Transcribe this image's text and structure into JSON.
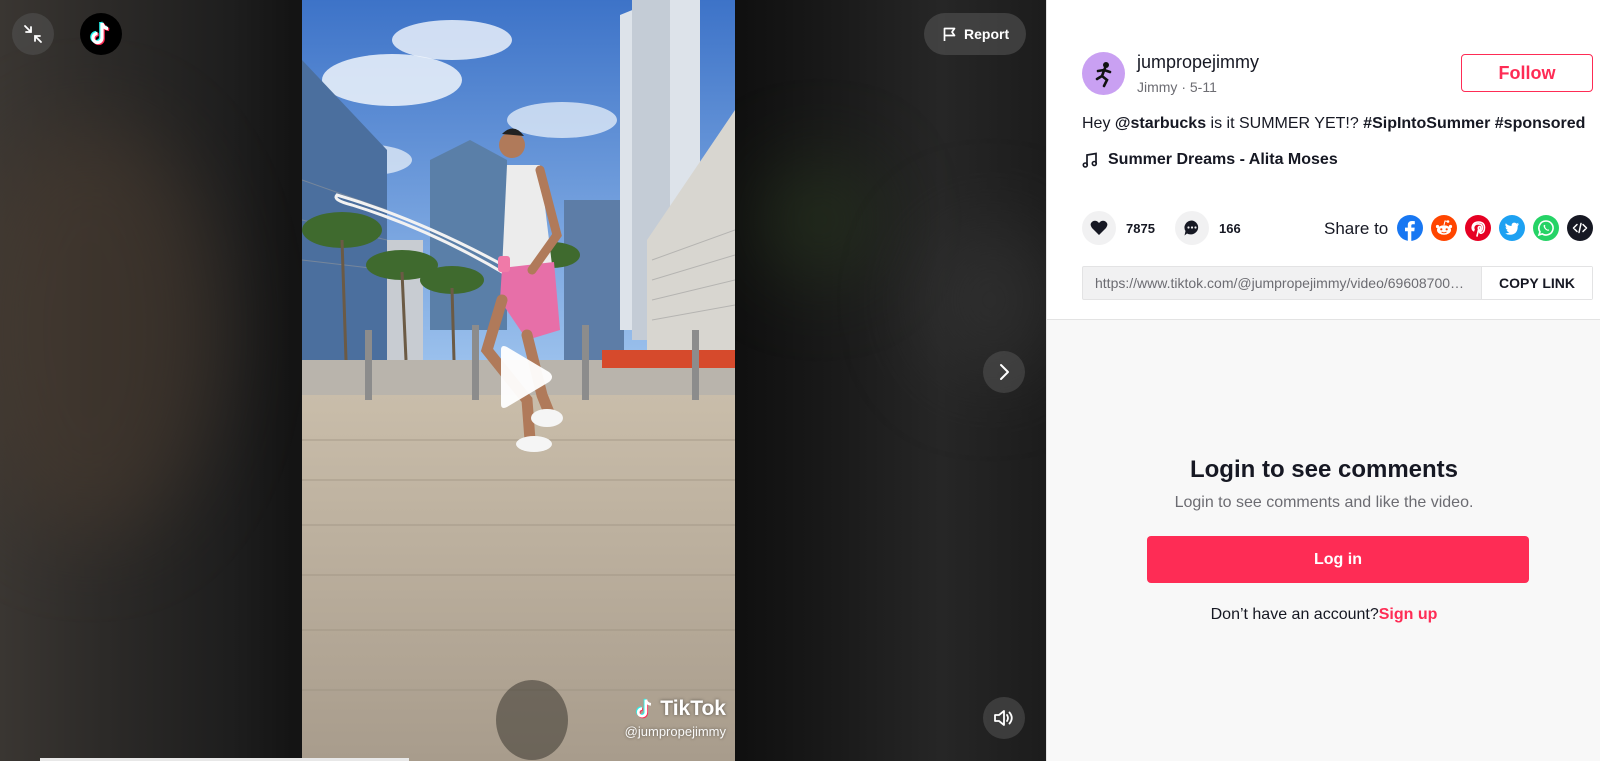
{
  "video": {
    "report_label": "Report",
    "watermark_brand": "TikTok",
    "watermark_handle": "@jumpropejimmy",
    "progress": 0.36
  },
  "post": {
    "username": "jumpropejimmy",
    "display_name": "Jimmy",
    "separator": " · ",
    "date": "5-11",
    "follow_label": "Follow",
    "caption_prefix": "Hey ",
    "caption_mention": "@starbucks",
    "caption_middle": " is it SUMMER YET!? ",
    "caption_tag1": "#SipIntoSummer",
    "caption_space": " ",
    "caption_tag2": "#sponsored",
    "music": "Summer Dreams - Alita Moses",
    "likes": "7875",
    "comments": "166",
    "share_label": "Share to",
    "share_targets": [
      "facebook-icon",
      "reddit-icon",
      "pinterest-icon",
      "twitter-icon",
      "whatsapp-icon",
      "embed-icon"
    ],
    "link": "https://www.tiktok.com/@jumpropejimmy/video/6960870000000000000",
    "copy_link_label": "COPY LINK"
  },
  "login": {
    "title": "Login to see comments",
    "subtitle": "Login to see comments and like the video.",
    "login_label": "Log in",
    "signup_prompt": "Don’t have an account?",
    "signup_label": "Sign up"
  },
  "colors": {
    "accent": "#fe2c55",
    "avatar_bg": "#c9a0f2",
    "facebook": "#1877f2",
    "reddit": "#ff4500",
    "pinterest": "#e60023",
    "twitter": "#1da1f2",
    "whatsapp": "#25d366",
    "embed": "#161823"
  }
}
